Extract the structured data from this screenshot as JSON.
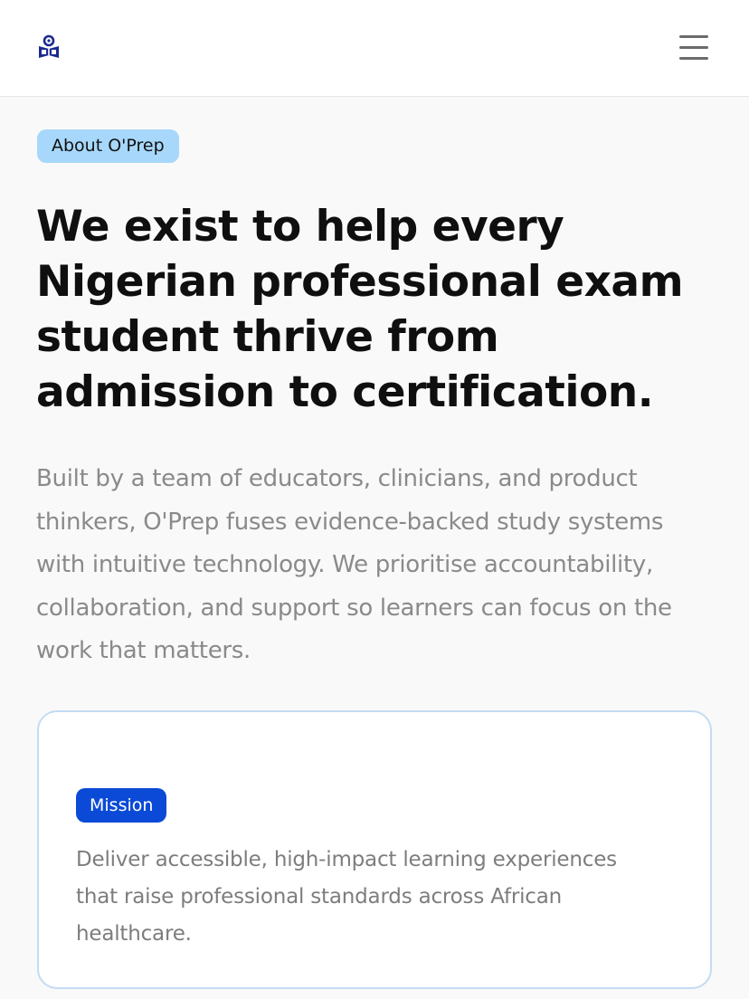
{
  "header": {
    "logo_icon": "person-reading-book-icon",
    "menu_icon": "hamburger-menu-icon",
    "brand_color": "#1b2a8f"
  },
  "hero": {
    "badge": "About O'Prep",
    "headline": "We exist to help every Nigerian professional exam student thrive from admission to certification.",
    "lead": "Built by a team of educators, clinicians, and product thinkers, O'Prep fuses evidence-backed study systems with intuitive technology. We prioritise accountability, collaboration, and support so learners can focus on the work that matters."
  },
  "mission_card": {
    "badge": "Mission",
    "text": "Deliver accessible, high-impact learning experiences that raise professional standards across African healthcare."
  },
  "colors": {
    "badge_bg": "#a7d8fb",
    "mission_badge_bg": "#0a4ad6",
    "headline": "#0f0f0f",
    "body_text": "#8a8a8a",
    "card_border": "#c4dbf3"
  }
}
